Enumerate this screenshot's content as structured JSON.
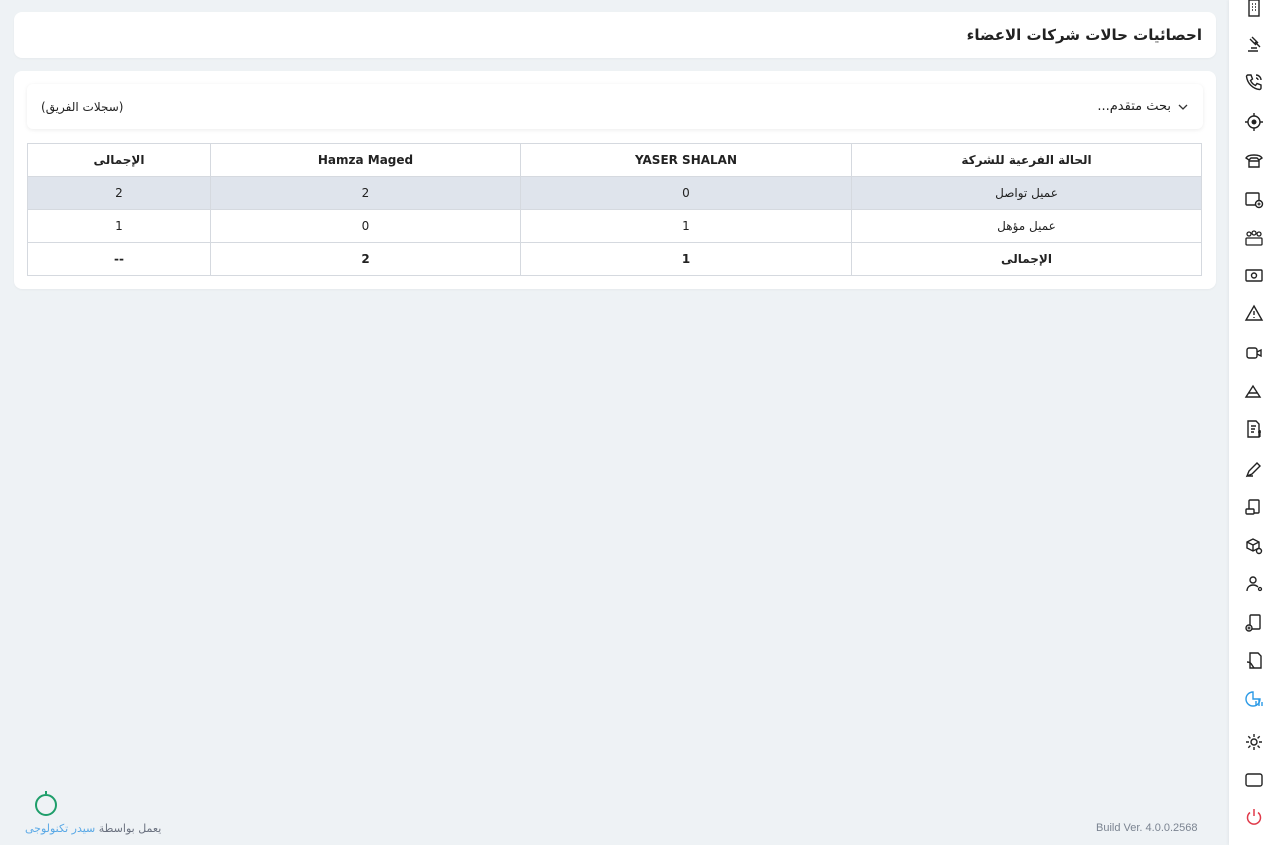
{
  "page": {
    "title": "احصائيات حالات شركات الاعضاء"
  },
  "search": {
    "advanced_label": "بحث متقدم...",
    "team_logs_label": "(سجلات الفريق)"
  },
  "table": {
    "headers": [
      "الحالة الفرعية للشركة",
      "YASER SHALAN",
      "Hamza Maged",
      "الإجمالى"
    ],
    "rows": [
      [
        "عميل تواصل",
        "0",
        "2",
        "2"
      ],
      [
        "عميل مؤهل",
        "1",
        "0",
        "1"
      ]
    ],
    "total_row": [
      "الإجمالى",
      "1",
      "2",
      "--"
    ]
  },
  "sidebar": {
    "items": [
      "building-icon",
      "gavel-icon",
      "phone-call-icon",
      "location-target-icon",
      "telephone-icon",
      "calendar-add-icon",
      "group-icon",
      "money-icon",
      "warning-icon",
      "video-call-icon",
      "mountain-icon",
      "invoice-dollar-icon",
      "pen-icon",
      "ticket-icon",
      "shipping-box-icon",
      "user-route-icon",
      "add-document-icon",
      "hand-document-icon",
      "pie-chart-icon",
      "settings-icon",
      "window-icon",
      "power-icon"
    ],
    "active_index": 18,
    "active_color": "#2b9ae6",
    "logout_color": "#e03a4a"
  },
  "footer": {
    "build": "Build Ver. 4.0.0.2568",
    "powered_prefix": "يعمل بواسطة",
    "powered_brand": "سيدر تكنولوجى"
  }
}
